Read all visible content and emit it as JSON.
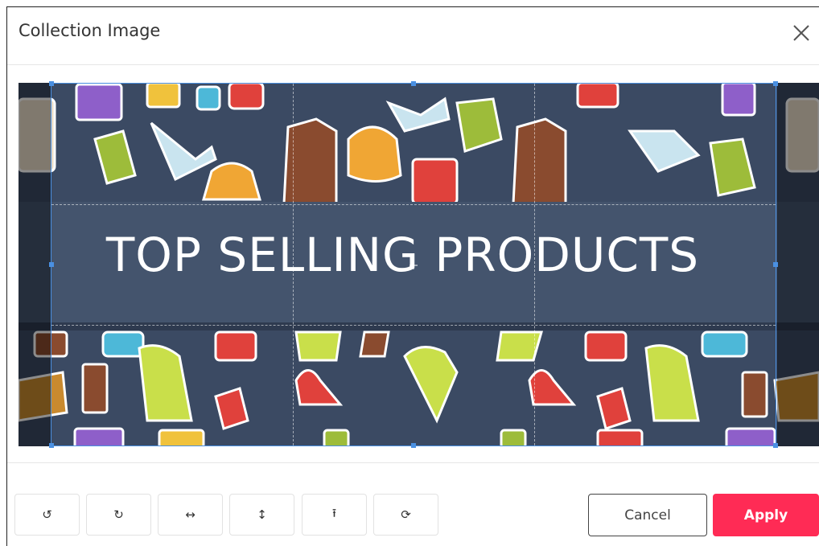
{
  "dialog": {
    "title": "Collection Image"
  },
  "image": {
    "banner_text": "TOP SELLING PRODUCTS",
    "background_color": "#3b4a63"
  },
  "toolbar": {
    "tools": [
      {
        "name": "rotate-left",
        "glyph": "↺"
      },
      {
        "name": "rotate-right",
        "glyph": "↻"
      },
      {
        "name": "flip-horizontal",
        "glyph": "↔"
      },
      {
        "name": "flip-vertical",
        "glyph": "↕"
      },
      {
        "name": "upload",
        "glyph": "⭱"
      },
      {
        "name": "reset",
        "glyph": "⟳"
      }
    ]
  },
  "actions": {
    "cancel_label": "Cancel",
    "apply_label": "Apply",
    "apply_color": "#ff2b55"
  },
  "colors": {
    "crop_border": "#4a90e2"
  }
}
